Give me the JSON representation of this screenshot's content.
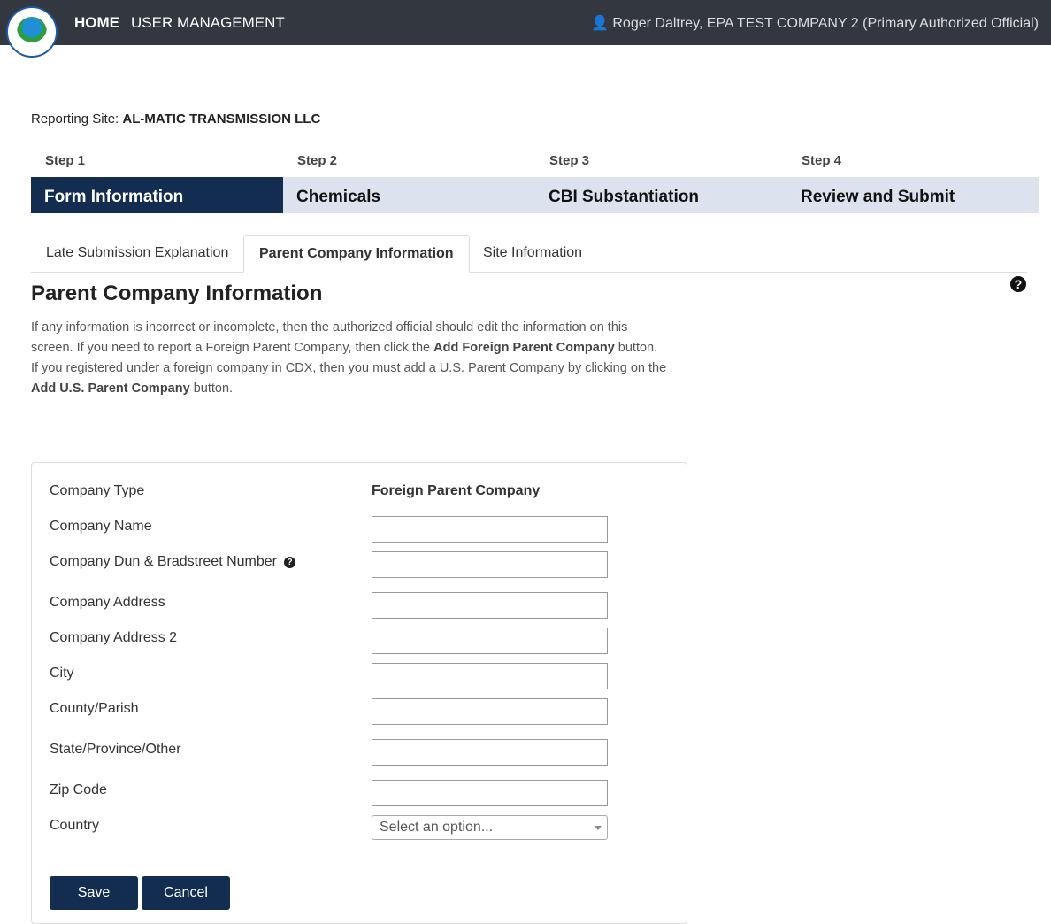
{
  "header": {
    "home": "HOME",
    "user_management": "USER MANAGEMENT",
    "user": "Roger Daltrey, EPA TEST COMPANY 2 (Primary Authorized Official)"
  },
  "site": {
    "label": "Reporting Site:",
    "value": "AL-MATIC TRANSMISSION LLC"
  },
  "steps": [
    {
      "step": "Step 1",
      "title": "Form Information"
    },
    {
      "step": "Step 2",
      "title": "Chemicals"
    },
    {
      "step": "Step 3",
      "title": "CBI Substantiation"
    },
    {
      "step": "Step 4",
      "title": "Review and Submit"
    }
  ],
  "tabs": [
    "Late Submission Explanation",
    "Parent Company Information",
    "Site Information"
  ],
  "page": {
    "title": "Parent Company Information",
    "desc": [
      "If any information is incorrect or incomplete, then the authorized official should edit the information on this screen. If you need to report a Foreign Parent Company, then click the ",
      "Add Foreign Parent Company",
      " button. If you registered under a foreign company in CDX, then you must add a U.S. Parent Company by clicking on the ",
      "Add U.S. Parent Company",
      " button."
    ]
  },
  "form": {
    "company_type_label": "Company Type",
    "company_type_value": "Foreign Parent Company",
    "fields": [
      "Company Name",
      "Company Dun & Bradstreet Number",
      "Company Address",
      "Company Address 2",
      "City",
      "County/Parish",
      "State/Province/Other",
      "Zip Code"
    ],
    "country_label": "Country",
    "country_placeholder": "Select an option...",
    "save": "Save",
    "cancel": "Cancel"
  }
}
